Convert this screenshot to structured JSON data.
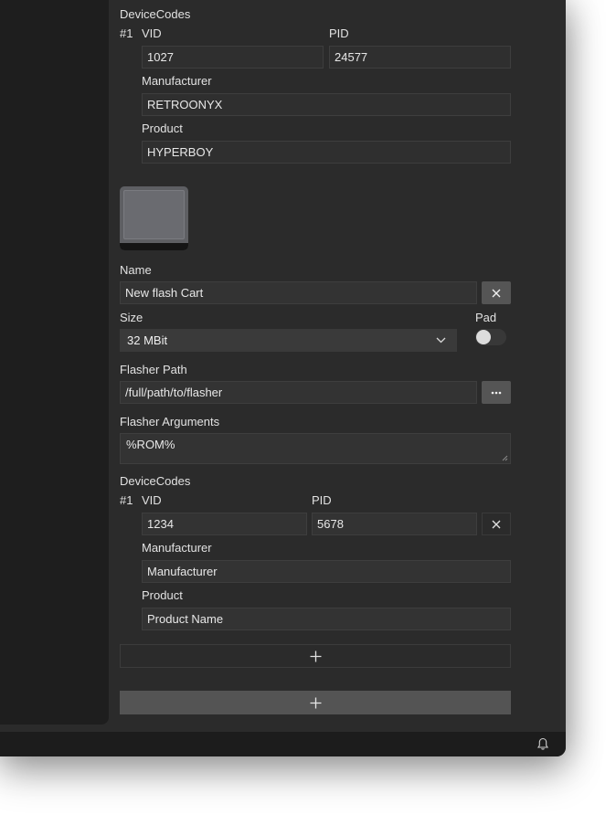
{
  "device_codes_1": {
    "heading": "DeviceCodes",
    "entry_index": "#1",
    "vid_label": "VID",
    "vid_value": "1027",
    "pid_label": "PID",
    "pid_value": "24577",
    "manufacturer_label": "Manufacturer",
    "manufacturer_value": "RETROONYX",
    "product_label": "Product",
    "product_value": "HYPERBOY"
  },
  "cart": {
    "name_label": "Name",
    "name_value": "New flash Cart",
    "size_label": "Size",
    "size_value": "32 MBit",
    "pad_label": "Pad",
    "pad_on": false,
    "flasher_path_label": "Flasher Path",
    "flasher_path_value": "/full/path/to/flasher",
    "flasher_args_label": "Flasher Arguments",
    "flasher_args_value": "%ROM%"
  },
  "device_codes_2": {
    "heading": "DeviceCodes",
    "entry_index": "#1",
    "vid_label": "VID",
    "vid_value": "1234",
    "pid_label": "PID",
    "pid_value": "5678",
    "manufacturer_label": "Manufacturer",
    "manufacturer_placeholder": "Manufacturer",
    "product_label": "Product",
    "product_placeholder": "Product Name"
  },
  "icons": {
    "remove": "close-icon",
    "browse": "ellipsis-icon",
    "dropdown": "chevron-down-icon",
    "add": "plus-icon",
    "notifications": "bell-icon"
  }
}
